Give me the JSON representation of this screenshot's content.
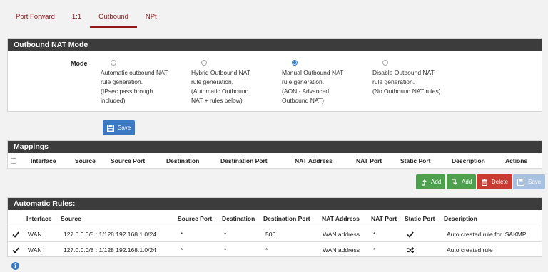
{
  "tabs": [
    "Port Forward",
    "1:1",
    "Outbound",
    "NPt"
  ],
  "active_tab": "Outbound",
  "mode_panel": {
    "title": "Outbound NAT Mode",
    "label": "Mode",
    "options": [
      {
        "text": "Automatic outbound NAT\nrule generation.\n(IPsec passthrough\nincluded)",
        "checked": false
      },
      {
        "text": "Hybrid Outbound NAT\nrule generation.\n(Automatic Outbound\nNAT + rules below)",
        "checked": false
      },
      {
        "text": "Manual Outbound NAT\nrule generation.\n(AON - Advanced\nOutbound NAT)",
        "checked": true
      },
      {
        "text": "Disable Outbound NAT\nrule generation.\n(No Outbound NAT rules)",
        "checked": false
      }
    ],
    "save_label": "Save"
  },
  "mappings": {
    "title": "Mappings",
    "columns": [
      "Interface",
      "Source",
      "Source Port",
      "Destination",
      "Destination Port",
      "NAT Address",
      "NAT Port",
      "Static Port",
      "Description",
      "Actions"
    ],
    "buttons": {
      "add_top": "Add",
      "add_bottom": "Add",
      "delete": "Delete",
      "save": "Save"
    }
  },
  "auto_rules": {
    "title": "Automatic Rules:",
    "columns": [
      "Interface",
      "Source",
      "Source Port",
      "Destination",
      "Destination Port",
      "NAT Address",
      "NAT Port",
      "Static Port",
      "Description"
    ],
    "rows": [
      {
        "interface": "WAN",
        "source": "127.0.0.0/8 ::1/128 192.168.1.0/24",
        "source_port": "*",
        "destination": "*",
        "destination_port": "500",
        "nat_address": "WAN address",
        "nat_port": "*",
        "static_port_icon": "check-icon",
        "description": "Auto created rule for ISAKMP"
      },
      {
        "interface": "WAN",
        "source": "127.0.0.0/8 ::1/128 192.168.1.0/24",
        "source_port": "*",
        "destination": "*",
        "destination_port": "*",
        "nat_address": "WAN address",
        "nat_port": "*",
        "static_port_icon": "shuffle-icon",
        "description": "Auto created rule"
      }
    ]
  },
  "colors": {
    "accent": "#8b1a1a",
    "header": "#3c3c3c",
    "primary": "#3b78c4",
    "success": "#4ea04e",
    "danger": "#c93a32"
  }
}
